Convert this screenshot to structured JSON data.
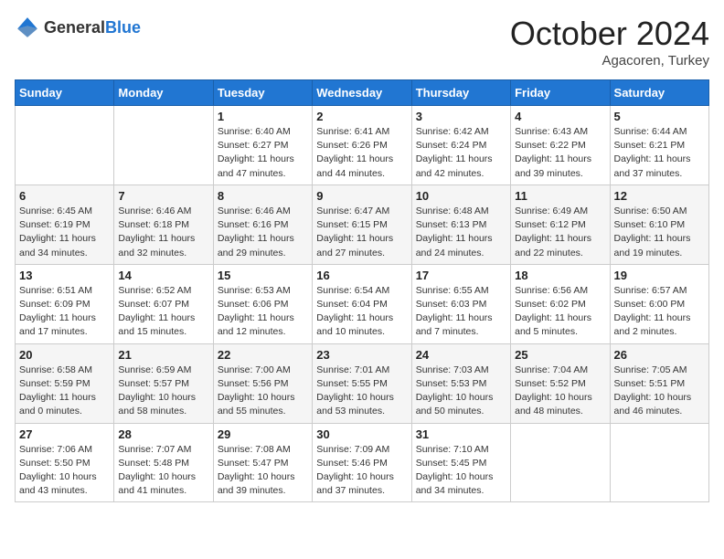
{
  "header": {
    "logo_general": "General",
    "logo_blue": "Blue",
    "month_title": "October 2024",
    "subtitle": "Agacoren, Turkey"
  },
  "days_of_week": [
    "Sunday",
    "Monday",
    "Tuesday",
    "Wednesday",
    "Thursday",
    "Friday",
    "Saturday"
  ],
  "weeks": [
    [
      {
        "day": "",
        "sunrise": "",
        "sunset": "",
        "daylight": ""
      },
      {
        "day": "",
        "sunrise": "",
        "sunset": "",
        "daylight": ""
      },
      {
        "day": "1",
        "sunrise": "Sunrise: 6:40 AM",
        "sunset": "Sunset: 6:27 PM",
        "daylight": "Daylight: 11 hours and 47 minutes."
      },
      {
        "day": "2",
        "sunrise": "Sunrise: 6:41 AM",
        "sunset": "Sunset: 6:26 PM",
        "daylight": "Daylight: 11 hours and 44 minutes."
      },
      {
        "day": "3",
        "sunrise": "Sunrise: 6:42 AM",
        "sunset": "Sunset: 6:24 PM",
        "daylight": "Daylight: 11 hours and 42 minutes."
      },
      {
        "day": "4",
        "sunrise": "Sunrise: 6:43 AM",
        "sunset": "Sunset: 6:22 PM",
        "daylight": "Daylight: 11 hours and 39 minutes."
      },
      {
        "day": "5",
        "sunrise": "Sunrise: 6:44 AM",
        "sunset": "Sunset: 6:21 PM",
        "daylight": "Daylight: 11 hours and 37 minutes."
      }
    ],
    [
      {
        "day": "6",
        "sunrise": "Sunrise: 6:45 AM",
        "sunset": "Sunset: 6:19 PM",
        "daylight": "Daylight: 11 hours and 34 minutes."
      },
      {
        "day": "7",
        "sunrise": "Sunrise: 6:46 AM",
        "sunset": "Sunset: 6:18 PM",
        "daylight": "Daylight: 11 hours and 32 minutes."
      },
      {
        "day": "8",
        "sunrise": "Sunrise: 6:46 AM",
        "sunset": "Sunset: 6:16 PM",
        "daylight": "Daylight: 11 hours and 29 minutes."
      },
      {
        "day": "9",
        "sunrise": "Sunrise: 6:47 AM",
        "sunset": "Sunset: 6:15 PM",
        "daylight": "Daylight: 11 hours and 27 minutes."
      },
      {
        "day": "10",
        "sunrise": "Sunrise: 6:48 AM",
        "sunset": "Sunset: 6:13 PM",
        "daylight": "Daylight: 11 hours and 24 minutes."
      },
      {
        "day": "11",
        "sunrise": "Sunrise: 6:49 AM",
        "sunset": "Sunset: 6:12 PM",
        "daylight": "Daylight: 11 hours and 22 minutes."
      },
      {
        "day": "12",
        "sunrise": "Sunrise: 6:50 AM",
        "sunset": "Sunset: 6:10 PM",
        "daylight": "Daylight: 11 hours and 19 minutes."
      }
    ],
    [
      {
        "day": "13",
        "sunrise": "Sunrise: 6:51 AM",
        "sunset": "Sunset: 6:09 PM",
        "daylight": "Daylight: 11 hours and 17 minutes."
      },
      {
        "day": "14",
        "sunrise": "Sunrise: 6:52 AM",
        "sunset": "Sunset: 6:07 PM",
        "daylight": "Daylight: 11 hours and 15 minutes."
      },
      {
        "day": "15",
        "sunrise": "Sunrise: 6:53 AM",
        "sunset": "Sunset: 6:06 PM",
        "daylight": "Daylight: 11 hours and 12 minutes."
      },
      {
        "day": "16",
        "sunrise": "Sunrise: 6:54 AM",
        "sunset": "Sunset: 6:04 PM",
        "daylight": "Daylight: 11 hours and 10 minutes."
      },
      {
        "day": "17",
        "sunrise": "Sunrise: 6:55 AM",
        "sunset": "Sunset: 6:03 PM",
        "daylight": "Daylight: 11 hours and 7 minutes."
      },
      {
        "day": "18",
        "sunrise": "Sunrise: 6:56 AM",
        "sunset": "Sunset: 6:02 PM",
        "daylight": "Daylight: 11 hours and 5 minutes."
      },
      {
        "day": "19",
        "sunrise": "Sunrise: 6:57 AM",
        "sunset": "Sunset: 6:00 PM",
        "daylight": "Daylight: 11 hours and 2 minutes."
      }
    ],
    [
      {
        "day": "20",
        "sunrise": "Sunrise: 6:58 AM",
        "sunset": "Sunset: 5:59 PM",
        "daylight": "Daylight: 11 hours and 0 minutes."
      },
      {
        "day": "21",
        "sunrise": "Sunrise: 6:59 AM",
        "sunset": "Sunset: 5:57 PM",
        "daylight": "Daylight: 10 hours and 58 minutes."
      },
      {
        "day": "22",
        "sunrise": "Sunrise: 7:00 AM",
        "sunset": "Sunset: 5:56 PM",
        "daylight": "Daylight: 10 hours and 55 minutes."
      },
      {
        "day": "23",
        "sunrise": "Sunrise: 7:01 AM",
        "sunset": "Sunset: 5:55 PM",
        "daylight": "Daylight: 10 hours and 53 minutes."
      },
      {
        "day": "24",
        "sunrise": "Sunrise: 7:03 AM",
        "sunset": "Sunset: 5:53 PM",
        "daylight": "Daylight: 10 hours and 50 minutes."
      },
      {
        "day": "25",
        "sunrise": "Sunrise: 7:04 AM",
        "sunset": "Sunset: 5:52 PM",
        "daylight": "Daylight: 10 hours and 48 minutes."
      },
      {
        "day": "26",
        "sunrise": "Sunrise: 7:05 AM",
        "sunset": "Sunset: 5:51 PM",
        "daylight": "Daylight: 10 hours and 46 minutes."
      }
    ],
    [
      {
        "day": "27",
        "sunrise": "Sunrise: 7:06 AM",
        "sunset": "Sunset: 5:50 PM",
        "daylight": "Daylight: 10 hours and 43 minutes."
      },
      {
        "day": "28",
        "sunrise": "Sunrise: 7:07 AM",
        "sunset": "Sunset: 5:48 PM",
        "daylight": "Daylight: 10 hours and 41 minutes."
      },
      {
        "day": "29",
        "sunrise": "Sunrise: 7:08 AM",
        "sunset": "Sunset: 5:47 PM",
        "daylight": "Daylight: 10 hours and 39 minutes."
      },
      {
        "day": "30",
        "sunrise": "Sunrise: 7:09 AM",
        "sunset": "Sunset: 5:46 PM",
        "daylight": "Daylight: 10 hours and 37 minutes."
      },
      {
        "day": "31",
        "sunrise": "Sunrise: 7:10 AM",
        "sunset": "Sunset: 5:45 PM",
        "daylight": "Daylight: 10 hours and 34 minutes."
      },
      {
        "day": "",
        "sunrise": "",
        "sunset": "",
        "daylight": ""
      },
      {
        "day": "",
        "sunrise": "",
        "sunset": "",
        "daylight": ""
      }
    ]
  ]
}
